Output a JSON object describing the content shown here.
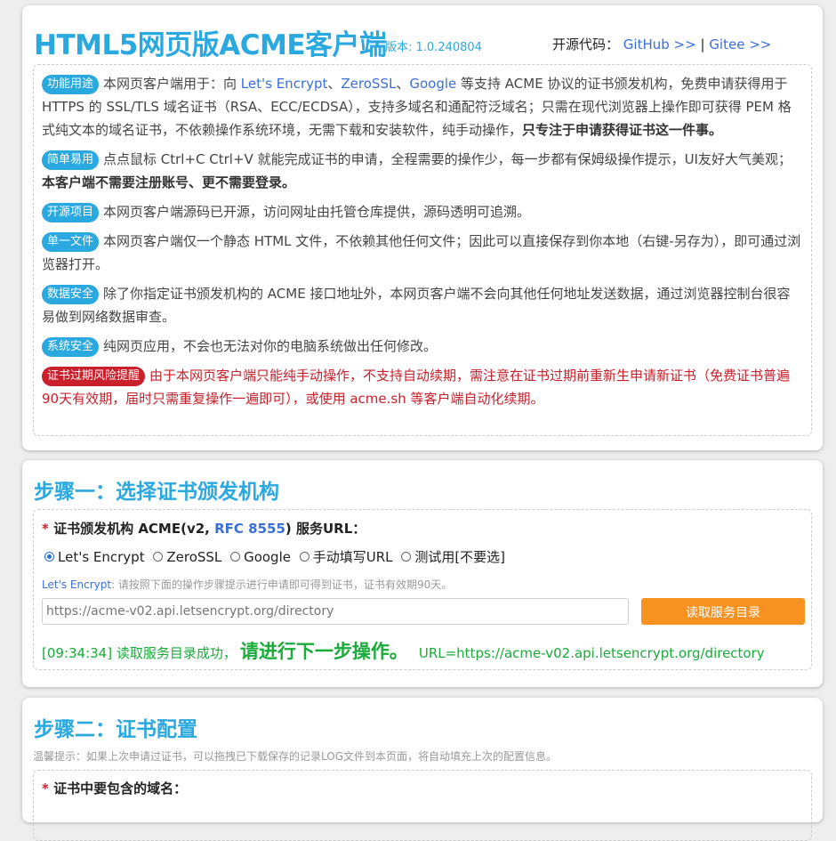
{
  "header": {
    "title": "HTML5网页版ACME客户端",
    "version": "版本: 1.0.240804",
    "source_label": "开源代码：",
    "github": "GitHub >>",
    "separator": "|",
    "gitee": "Gitee >>"
  },
  "features": [
    {
      "badge": "功能用途",
      "t1": "本网页客户端用于：向 ",
      "l1": "Let's Encrypt",
      "t2": "、",
      "l2": "ZeroSSL",
      "t3": "、",
      "l3": "Google",
      "t4": " 等支持 ACME 协议的证书颁发机构，免费申请获得用于 HTTPS 的 SSL/TLS 域名证书（RSA、ECC/ECDSA），支持多域名和通配符泛域名；只需在现代浏览器上操作即可获得 PEM 格式纯文本的域名证书，不依赖操作系统环境，无需下载和安装软件，纯手动操作，",
      "bold": "只专注于申请获得证书这一件事。"
    },
    {
      "badge": "简单易用",
      "text": "点点鼠标 Ctrl+C Ctrl+V 就能完成证书的申请，全程需要的操作少，每一步都有保姆级操作提示，UI友好大气美观；",
      "bold": "本客户端不需要注册账号、更不需要登录。"
    },
    {
      "badge": "开源项目",
      "text": "本网页客户端源码已开源，访问网址由托管仓库提供，源码透明可追溯。"
    },
    {
      "badge": "单一文件",
      "text": "本网页客户端仅一个静态 HTML 文件，不依赖其他任何文件；因此可以直接保存到你本地（右键-另存为），即可通过浏览器打开。"
    },
    {
      "badge": "数据安全",
      "text": "除了你指定证书颁发机构的 ACME 接口地址外，本网页客户端不会向其他任何地址发送数据，通过浏览器控制台很容易做到网络数据审查。"
    },
    {
      "badge": "系统安全",
      "text": "纯网页应用，不会也无法对你的电脑系统做出任何修改。"
    },
    {
      "badge": "证书过期风险提醒",
      "text": "由于本网页客户端只能纯手动操作，不支持自动续期，需注意在证书过期前重新生申请新证书（免费证书普遍90天有效期，届时只需重复操作一遍即可），或使用 acme.sh 等客户端自动化续期。"
    }
  ],
  "step1": {
    "title": "步骤一：选择证书颁发机构",
    "required_mark": "*",
    "label_a": "证书颁发机构 ACME(v2, ",
    "label_link": "RFC 8555",
    "label_b": ") 服务URL：",
    "radios": [
      "Let's Encrypt",
      "ZeroSSL",
      "Google",
      "手动填写URL",
      "测试用[不要选]"
    ],
    "hint_name": "Let's Encrypt",
    "hint_text": ": 请按照下面的操作步骤提示进行申请即可得到证书，证书有效期90天。",
    "url_placeholder": "https://acme-v02.api.letsencrypt.org/directory",
    "read_button": "读取服务目录",
    "status_time": "[09:34:34] 读取服务目录成功，",
    "status_big": "请进行下一步操作。",
    "status_url": "URL=https://acme-v02.api.letsencrypt.org/directory"
  },
  "step2": {
    "title": "步骤二：证书配置",
    "tip": "温馨提示：如果上次申请过证书，可以拖拽已下载保存的记录LOG文件到本页面，将自动填充上次的配置信息。",
    "required_mark": "*",
    "domain_label": "证书中要包含的域名："
  }
}
